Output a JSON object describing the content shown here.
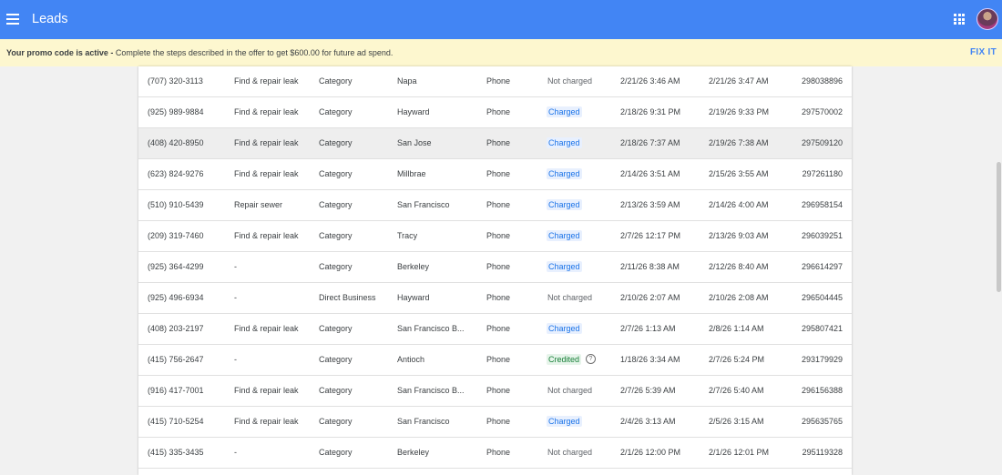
{
  "header": {
    "title": "Leads",
    "menu_icon": "hamburger-menu-icon",
    "apps_icon": "apps-grid-icon",
    "brand_color": "#4285f4"
  },
  "promo": {
    "bold_text": "Your promo code is active -",
    "text": " Complete the steps described in the offer to get $600.00 for future ad spend.",
    "action": "FIX IT"
  },
  "rows": [
    {
      "phone": "(707) 320-3113",
      "job": "Find & repair leak",
      "type": "Category",
      "location": "Napa",
      "lead_type": "Phone",
      "status": "Not charged",
      "status_kind": "plain",
      "received": "2/21/26 3:46 AM",
      "updated": "2/21/26 3:47 AM",
      "id": "298038896"
    },
    {
      "phone": "(925) 989-9884",
      "job": "Find & repair leak",
      "type": "Category",
      "location": "Hayward",
      "lead_type": "Phone",
      "status": "Charged",
      "status_kind": "charged",
      "received": "2/18/26 9:31 PM",
      "updated": "2/19/26 9:33 PM",
      "id": "297570002"
    },
    {
      "phone": "(408) 420-8950",
      "job": "Find & repair leak",
      "type": "Category",
      "location": "San Jose",
      "lead_type": "Phone",
      "status": "Charged",
      "status_kind": "charged",
      "received": "2/18/26 7:37 AM",
      "updated": "2/19/26 7:38 AM",
      "id": "297509120"
    },
    {
      "phone": "(623) 824-9276",
      "job": "Find & repair leak",
      "type": "Category",
      "location": "Millbrae",
      "lead_type": "Phone",
      "status": "Charged",
      "status_kind": "charged",
      "received": "2/14/26 3:51 AM",
      "updated": "2/15/26 3:55 AM",
      "id": "297261180"
    },
    {
      "phone": "(510) 910-5439",
      "job": "Repair sewer",
      "type": "Category",
      "location": "San Francisco",
      "lead_type": "Phone",
      "status": "Charged",
      "status_kind": "charged",
      "received": "2/13/26 3:59 AM",
      "updated": "2/14/26 4:00 AM",
      "id": "296958154"
    },
    {
      "phone": "(209) 319-7460",
      "job": "Find & repair leak",
      "type": "Category",
      "location": "Tracy",
      "lead_type": "Phone",
      "status": "Charged",
      "status_kind": "charged",
      "received": "2/7/26 12:17 PM",
      "updated": "2/13/26 9:03 AM",
      "id": "296039251"
    },
    {
      "phone": "(925) 364-4299",
      "job": "-",
      "type": "Category",
      "location": "Berkeley",
      "lead_type": "Phone",
      "status": "Charged",
      "status_kind": "charged",
      "received": "2/11/26 8:38 AM",
      "updated": "2/12/26 8:40 AM",
      "id": "296614297"
    },
    {
      "phone": "(925) 496-6934",
      "job": "-",
      "type": "Direct Business",
      "location": "Hayward",
      "lead_type": "Phone",
      "status": "Not charged",
      "status_kind": "plain",
      "received": "2/10/26 2:07 AM",
      "updated": "2/10/26 2:08 AM",
      "id": "296504445"
    },
    {
      "phone": "(408) 203-2197",
      "job": "Find & repair leak",
      "type": "Category",
      "location": "San Francisco B...",
      "lead_type": "Phone",
      "status": "Charged",
      "status_kind": "charged",
      "received": "2/7/26 1:13 AM",
      "updated": "2/8/26 1:14 AM",
      "id": "295807421"
    },
    {
      "phone": "(415) 756-2647",
      "job": "-",
      "type": "Category",
      "location": "Antioch",
      "lead_type": "Phone",
      "status": "Credited",
      "status_kind": "credited",
      "received": "1/18/26 3:34 AM",
      "updated": "2/7/26 5:24 PM",
      "id": "293179929"
    },
    {
      "phone": "(916) 417-7001",
      "job": "Find & repair leak",
      "type": "Category",
      "location": "San Francisco B...",
      "lead_type": "Phone",
      "status": "Not charged",
      "status_kind": "plain",
      "received": "2/7/26 5:39 AM",
      "updated": "2/7/26 5:40 AM",
      "id": "296156388"
    },
    {
      "phone": "(415) 710-5254",
      "job": "Find & repair leak",
      "type": "Category",
      "location": "San Francisco",
      "lead_type": "Phone",
      "status": "Charged",
      "status_kind": "charged",
      "received": "2/4/26 3:13 AM",
      "updated": "2/5/26 3:15 AM",
      "id": "295635765"
    },
    {
      "phone": "(415) 335-3435",
      "job": "-",
      "type": "Category",
      "location": "Berkeley",
      "lead_type": "Phone",
      "status": "Not charged",
      "status_kind": "plain",
      "received": "2/1/26 12:00 PM",
      "updated": "2/1/26 12:01 PM",
      "id": "295119328"
    }
  ]
}
